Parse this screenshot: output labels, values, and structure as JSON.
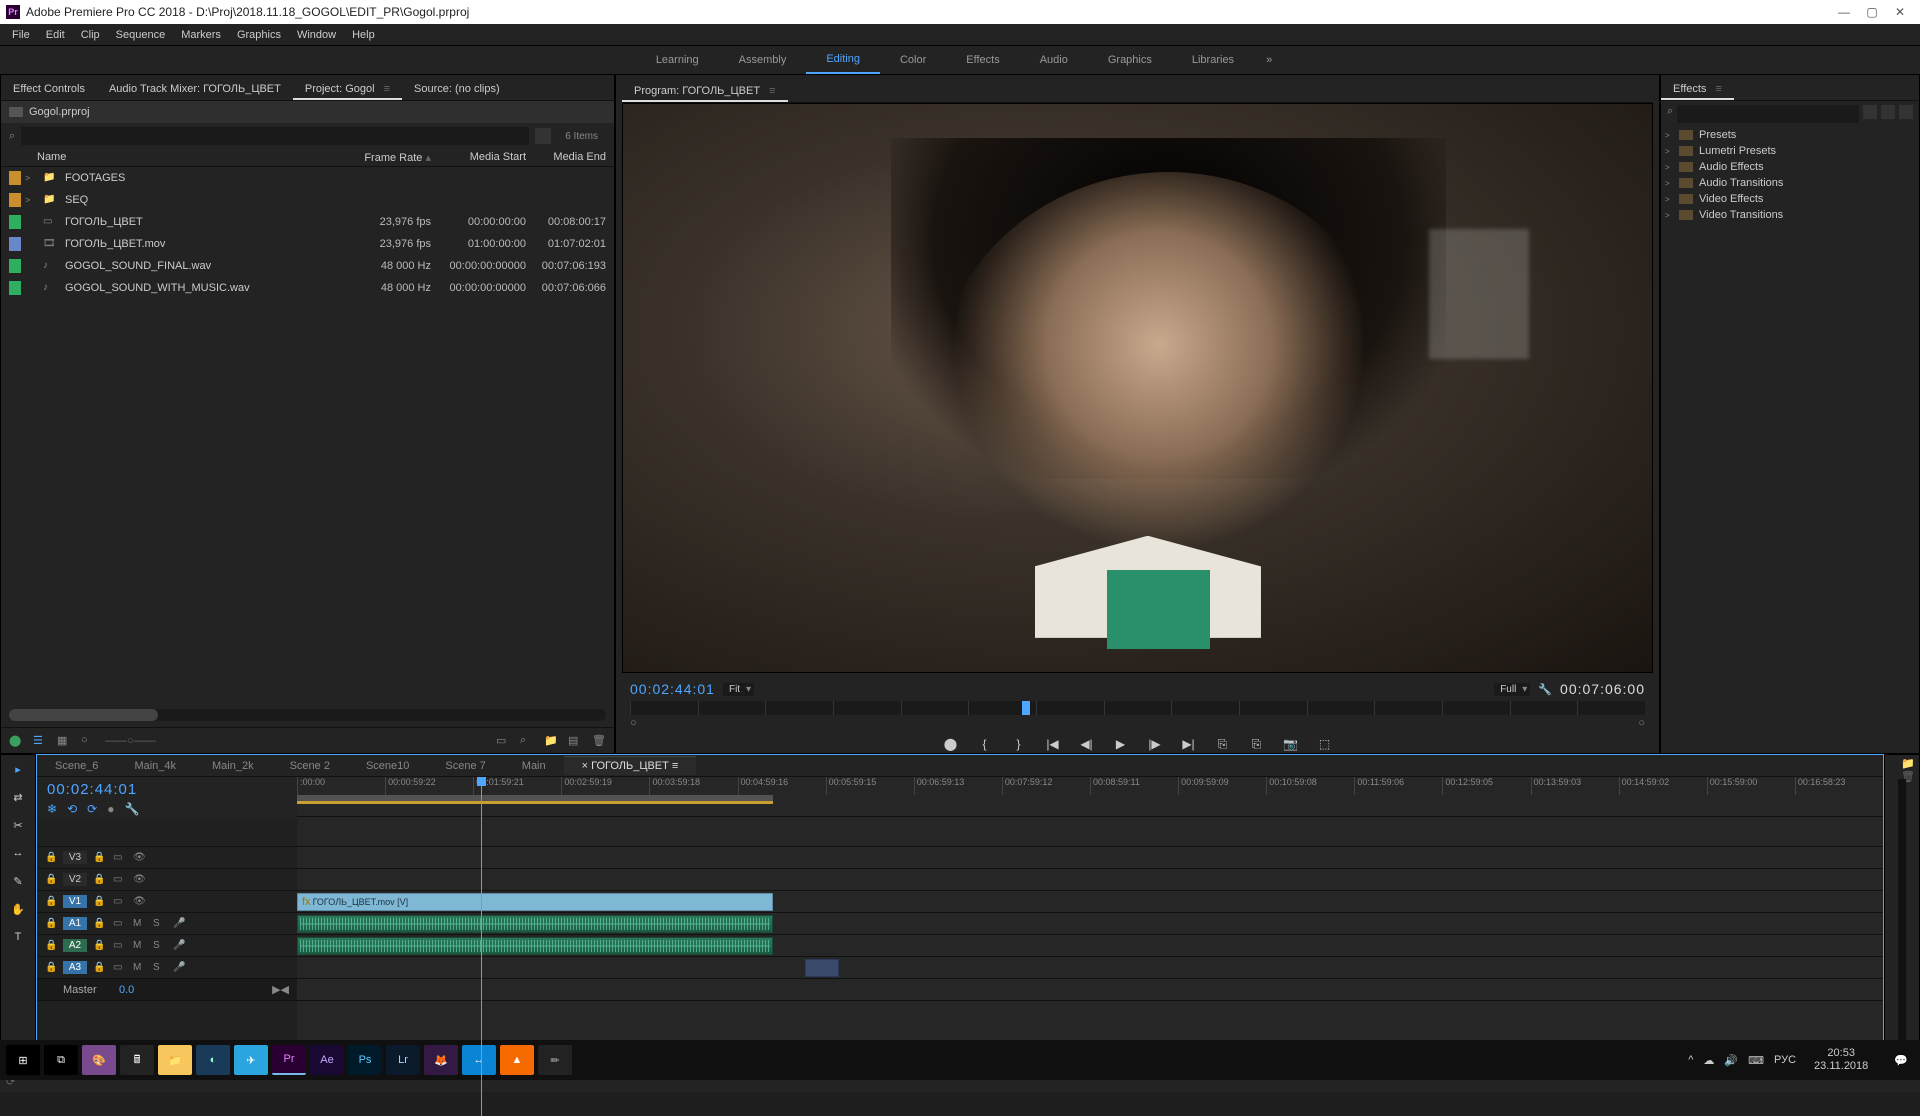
{
  "title_bar": {
    "app_icon": "Pr",
    "title": "Adobe Premiere Pro CC 2018 - D:\\Proj\\2018.11.18_GOGOL\\EDIT_PR\\Gogol.prproj"
  },
  "menu": [
    "File",
    "Edit",
    "Clip",
    "Sequence",
    "Markers",
    "Graphics",
    "Window",
    "Help"
  ],
  "workspaces": [
    "Learning",
    "Assembly",
    "Editing",
    "Color",
    "Effects",
    "Audio",
    "Graphics",
    "Libraries"
  ],
  "workspace_active": "Editing",
  "left_tabs": [
    {
      "label": "Effect Controls",
      "active": false
    },
    {
      "label": "Audio Track Mixer: ГОГОЛЬ_ЦВЕТ",
      "active": false
    },
    {
      "label": "Project: Gogol",
      "active": true
    },
    {
      "label": "Source: (no clips)",
      "active": false
    }
  ],
  "project": {
    "bin": "Gogol.prproj",
    "item_count": "6 Items",
    "columns": [
      "Name",
      "Frame Rate",
      "Media Start",
      "Media End"
    ],
    "rows": [
      {
        "chip": "#c98f2f",
        "arrow": ">",
        "icon": "folder",
        "name": "FOOTAGES",
        "fr": "",
        "ms": "",
        "me": ""
      },
      {
        "chip": "#c98f2f",
        "arrow": ">",
        "icon": "folder",
        "name": "SEQ",
        "fr": "",
        "ms": "",
        "me": ""
      },
      {
        "chip": "#2fae5f",
        "arrow": "",
        "icon": "seq",
        "name": "ГОГОЛЬ_ЦВЕТ",
        "fr": "23,976 fps",
        "ms": "00:00:00:00",
        "me": "00:08:00:17"
      },
      {
        "chip": "#6a87c9",
        "arrow": "",
        "icon": "video",
        "name": "ГОГОЛЬ_ЦВЕТ.mov",
        "fr": "23,976 fps",
        "ms": "01:00:00:00",
        "me": "01:07:02:01"
      },
      {
        "chip": "#2fae5f",
        "arrow": "",
        "icon": "audio",
        "name": "GOGOL_SOUND_FINAL.wav",
        "fr": "48 000 Hz",
        "ms": "00:00:00:00000",
        "me": "00:07:06:193"
      },
      {
        "chip": "#2fae5f",
        "arrow": "",
        "icon": "audio",
        "name": "GOGOL_SOUND_WITH_MUSIC.wav",
        "fr": "48 000 Hz",
        "ms": "00:00:00:00000",
        "me": "00:07:06:066"
      }
    ],
    "footer_zoom": "——○——"
  },
  "program": {
    "tab": "Program: ГОГОЛЬ_ЦВЕТ",
    "timecode_in": "00:02:44:01",
    "fit": "Fit",
    "quality": "Full",
    "timecode_out": "00:07:06:00",
    "transport": [
      "⬤",
      "{",
      "}",
      "|◀",
      "◀|",
      "▶",
      "|▶",
      "▶|",
      "⎘",
      "⎘",
      "📷",
      "⬚"
    ],
    "extra": [
      "⬚",
      "⬚"
    ],
    "add": "+"
  },
  "effects_panel": {
    "tab": "Effects",
    "icons": [
      "fx",
      "yuv",
      "32"
    ],
    "tree": [
      {
        "caret": ">",
        "name": "Presets"
      },
      {
        "caret": ">",
        "name": "Lumetri Presets"
      },
      {
        "caret": ">",
        "name": "Audio Effects"
      },
      {
        "caret": ">",
        "name": "Audio Transitions"
      },
      {
        "caret": ">",
        "name": "Video Effects"
      },
      {
        "caret": ">",
        "name": "Video Transitions"
      }
    ]
  },
  "tools": [
    "▸",
    "⇄",
    "✂",
    "↔",
    "✎",
    "✋",
    "T"
  ],
  "timeline": {
    "tabs": [
      "Scene_6",
      "Main_4k",
      "Main_2k",
      "Scene 2",
      "Scene10",
      "Scene 7",
      "Main",
      "ГОГОЛЬ_ЦВЕТ"
    ],
    "tab_active": "ГОГОЛЬ_ЦВЕТ",
    "timecode": "00:02:44:01",
    "head_icons": [
      "❄",
      "⟲",
      "⟳",
      "●",
      "🔧"
    ],
    "ruler": [
      ":00:00",
      "00:00:59:22",
      "00:01:59:21",
      "00:02:59:19",
      "00:03:59:18",
      "00:04:59:16",
      "00:05:59:15",
      "00:06:59:13",
      "00:07:59:12",
      "00:08:59:11",
      "00:09:59:09",
      "00:10:59:08",
      "00:11:59:06",
      "00:12:59:05",
      "00:13:59:03",
      "00:14:59:02",
      "00:15:59:00",
      "00:16:58:23"
    ],
    "tracks": [
      {
        "name": "V3",
        "type": "video",
        "sel": false,
        "toggles": [
          "🔒",
          "▭",
          "👁"
        ]
      },
      {
        "name": "V2",
        "type": "video",
        "sel": false,
        "toggles": [
          "🔒",
          "▭",
          "👁"
        ]
      },
      {
        "name": "V1",
        "type": "video",
        "sel": true,
        "toggles": [
          "🔒",
          "▭",
          "👁"
        ]
      },
      {
        "name": "A1",
        "type": "audio",
        "sel": true,
        "toggles": [
          "🔒",
          "▭",
          "M",
          "S",
          "🎤"
        ]
      },
      {
        "name": "A2",
        "type": "audio",
        "sel": false,
        "toggles": [
          "🔒",
          "▭",
          "M",
          "S",
          "🎤"
        ]
      },
      {
        "name": "A3",
        "type": "audio",
        "sel": true,
        "toggles": [
          "🔒",
          "▭",
          "M",
          "S",
          "🎤"
        ]
      }
    ],
    "master": {
      "name": "Master",
      "val": "0.0"
    },
    "video_clip": "ГОГОЛЬ_ЦВЕТ.mov [V]",
    "clip_fx": "fx"
  },
  "taskbar": {
    "icons": [
      {
        "bg": "#000",
        "txt": "⊞",
        "c": "#fff"
      },
      {
        "bg": "#000",
        "txt": "⧉",
        "c": "#fff"
      },
      {
        "bg": "#7a4a8f",
        "txt": "🎨",
        "c": "#fff"
      },
      {
        "bg": "#222",
        "txt": "🖩",
        "c": "#fff"
      },
      {
        "bg": "#f7c65d",
        "txt": "📁",
        "c": "#333"
      },
      {
        "bg": "#1a3a5a",
        "txt": "◐",
        "c": "#9fc"
      },
      {
        "bg": "#2aa5e0",
        "txt": "✈",
        "c": "#fff"
      },
      {
        "bg": "#2a0033",
        "txt": "Pr",
        "c": "#e482ff",
        "active": true
      },
      {
        "bg": "#1a0a33",
        "txt": "Ae",
        "c": "#c8a8ff"
      },
      {
        "bg": "#001a2a",
        "txt": "Ps",
        "c": "#5accff"
      },
      {
        "bg": "#0a1a2a",
        "txt": "Lr",
        "c": "#aad4ff"
      },
      {
        "bg": "#331a44",
        "txt": "🦊",
        "c": "#ff9c3a"
      },
      {
        "bg": "#0a85d4",
        "txt": "↔",
        "c": "#fff"
      },
      {
        "bg": "#f76a00",
        "txt": "▲",
        "c": "#fff"
      },
      {
        "bg": "#222",
        "txt": "✏",
        "c": "#aaa"
      }
    ],
    "tray": [
      "^",
      "☁",
      "🔊",
      "⌨",
      "РУС"
    ],
    "time": "20:53",
    "date": "23.11.2018"
  }
}
